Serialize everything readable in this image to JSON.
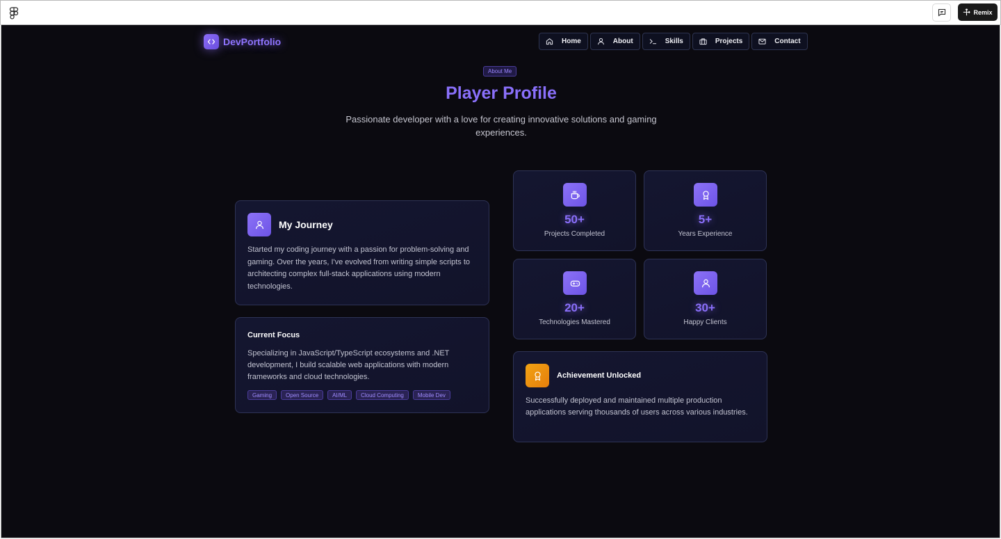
{
  "topbar": {
    "remix_label": "Remix",
    "figma_icon": "figma-logo-icon",
    "comment_icon": "comment-icon"
  },
  "brand": {
    "name": "DevPortfolio",
    "icon": "code-icon"
  },
  "nav": [
    {
      "label": "Home",
      "icon": "home-icon"
    },
    {
      "label": "About",
      "icon": "user-icon"
    },
    {
      "label": "Skills",
      "icon": "terminal-icon"
    },
    {
      "label": "Projects",
      "icon": "briefcase-icon"
    },
    {
      "label": "Contact",
      "icon": "mail-icon"
    }
  ],
  "hero": {
    "badge": "About Me",
    "title": "Player Profile",
    "subtitle": "Passionate developer with a love for creating innovative solutions and gaming experiences."
  },
  "journey": {
    "title": "My Journey",
    "icon": "user-icon",
    "text": "Started my coding journey with a passion for problem-solving and gaming. Over the years, I've evolved from writing simple scripts to architecting complex full-stack applications using modern technologies."
  },
  "focus": {
    "title": "Current Focus",
    "text": "Specializing in JavaScript/TypeScript ecosystems and .NET development, I build scalable web applications with modern frameworks and cloud technologies.",
    "tags": [
      "Gaming",
      "Open Source",
      "AI/ML",
      "Cloud Computing",
      "Mobile Dev"
    ]
  },
  "stats": [
    {
      "value": "50+",
      "label": "Projects Completed",
      "icon": "coffee-icon"
    },
    {
      "value": "5+",
      "label": "Years Experience",
      "icon": "award-icon"
    },
    {
      "value": "20+",
      "label": "Technologies Mastered",
      "icon": "gamepad-icon"
    },
    {
      "value": "30+",
      "label": "Happy Clients",
      "icon": "user-icon"
    }
  ],
  "achievement": {
    "title": "Achievement Unlocked",
    "icon": "award-icon",
    "text": "Successfully deployed and maintained multiple production applications serving thousands of users across various industries."
  },
  "colors": {
    "accent": "#8a70fb",
    "background": "#0b0a10",
    "card": "#141630",
    "achievement_icon": "#f2a313"
  }
}
